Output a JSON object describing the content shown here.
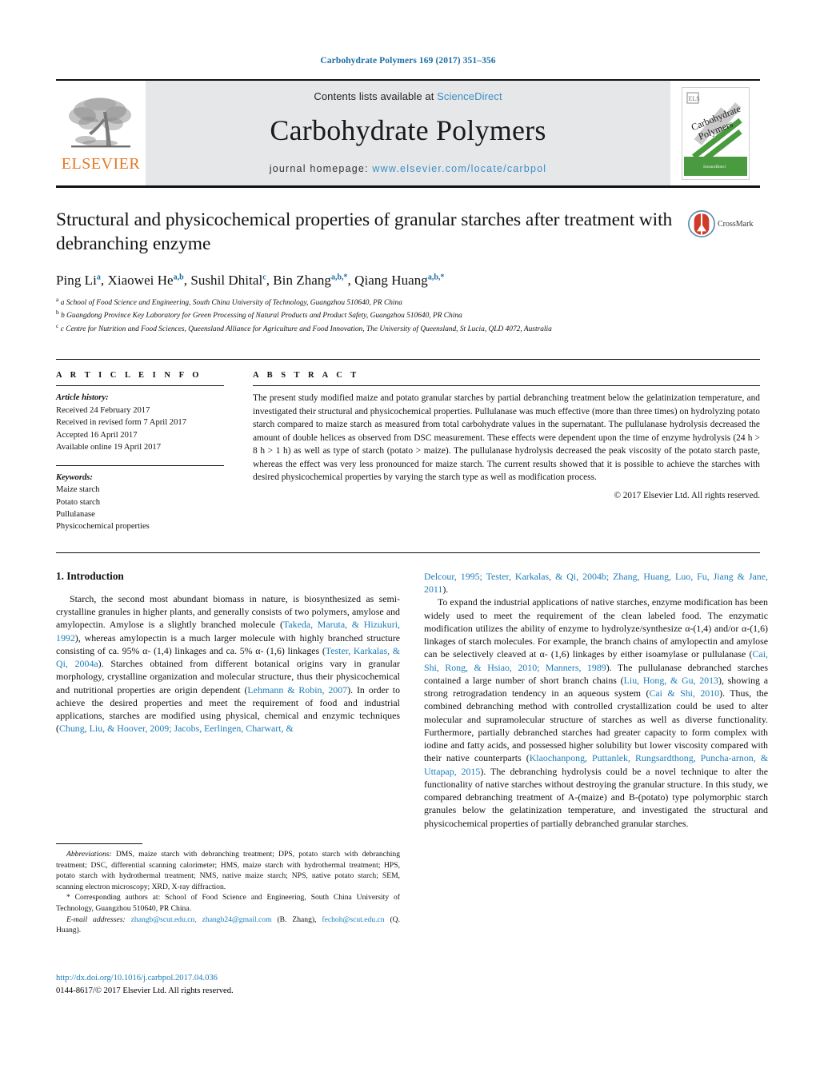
{
  "running_head": "Carbohydrate Polymers 169 (2017) 351–356",
  "masthead": {
    "contents_prefix": "Contents lists available at ",
    "sciencedirect": "ScienceDirect",
    "journal_name": "Carbohydrate Polymers",
    "homepage_prefix": "journal homepage: ",
    "homepage_url": "www.elsevier.com/locate/carbpol",
    "publisher_logo_text": "ELSEVIER",
    "cover_title_line1": "Carbohydrate",
    "cover_title_line2": "Polymers",
    "accent_blue": "#3b8ec4",
    "elsevier_orange": "#E87722",
    "masthead_grey": "#e6e7e8"
  },
  "article": {
    "title": "Structural and physicochemical properties of granular starches after treatment with debranching enzyme",
    "crossmark_label": "CrossMark",
    "authors_html": "Ping Li<sup>a</sup>, Xiaowei He<sup>a,b</sup>, Sushil Dhital<sup>c</sup>, Bin Zhang<sup>a,b,*</sup>, Qiang Huang<sup>a,b,*</sup>",
    "affiliations": [
      "a School of Food Science and Engineering, South China University of Technology, Guangzhou 510640, PR China",
      "b Guangdong Province Key Laboratory for Green Processing of Natural Products and Product Safety, Guangzhou 510640, PR China",
      "c Centre for Nutrition and Food Sciences, Queensland Alliance for Agriculture and Food Innovation, The University of Queensland, St Lucia, QLD 4072, Australia"
    ]
  },
  "article_info": {
    "heading": "A R T I C L E   I N F O",
    "history_label": "Article history:",
    "history": [
      "Received 24 February 2017",
      "Received in revised form 7 April 2017",
      "Accepted 16 April 2017",
      "Available online 19 April 2017"
    ],
    "keywords_label": "Keywords:",
    "keywords": [
      "Maize starch",
      "Potato starch",
      "Pullulanase",
      "Physicochemical properties"
    ]
  },
  "abstract": {
    "heading": "A B S T R A C T",
    "text": "The present study modified maize and potato granular starches by partial debranching treatment below the gelatinization temperature, and investigated their structural and physicochemical properties. Pullulanase was much effective (more than three times) on hydrolyzing potato starch compared to maize starch as measured from total carbohydrate values in the supernatant. The pullulanase hydrolysis decreased the amount of double helices as observed from DSC measurement. These effects were dependent upon the time of enzyme hydrolysis (24 h > 8 h > 1 h) as well as type of starch (potato > maize). The pullulanase hydrolysis decreased the peak viscosity of the potato starch paste, whereas the effect was very less pronounced for maize starch. The current results showed that it is possible to achieve the starches with desired physicochemical properties by varying the starch type as well as modification process.",
    "copyright": "© 2017 Elsevier Ltd. All rights reserved."
  },
  "body": {
    "section_heading": "1.  Introduction",
    "left_paragraph_html": "Starch, the second most abundant biomass in nature, is biosynthesized as semi-crystalline granules in higher plants, and generally consists of two polymers, amylose and amylopectin. Amylose is a slightly branched molecule (<span class=\"ref\">Takeda, Maruta, &amp; Hizukuri, 1992</span>), whereas amylopectin is a much larger molecule with highly branched structure consisting of ca. 95% &#945;- (1,4) linkages and ca. 5% &#945;- (1,6) linkages (<span class=\"ref\">Tester, Karkalas, &amp; Qi, 2004a</span>). Starches obtained from different botanical origins vary in granular morphology, crystalline organization and molecular structure, thus their physicochemical and nutritional properties are origin dependent (<span class=\"ref\">Lehmann &amp; Robin, 2007</span>). In order to achieve the desired properties and meet the requirement of food and industrial applications, starches are modified using physical, chemical and enzymic techniques (<span class=\"ref\">Chung, Liu, &amp; Hoover, 2009; Jacobs, Eerlingen, Charwart, &amp;</span>",
    "right_paragraph1_html": "<span class=\"ref\">Delcour, 1995; Tester, Karkalas, &amp; Qi, 2004b; Zhang, Huang, Luo, Fu, Jiang &amp; Jane, 2011</span>).",
    "right_paragraph2_html": "To expand the industrial applications of native starches, enzyme modification has been widely used to meet the requirement of the clean labeled food. The enzymatic modification utilizes the ability of enzyme to hydrolyze/synthesize &#945;-(1,4) and/or &#945;-(1,6) linkages of starch molecules. For example, the branch chains of amylopectin and amylose can be selectively cleaved at &#945;- (1,6) linkages by either isoamylase or pullulanase (<span class=\"ref\">Cai, Shi, Rong, &amp; Hsiao, 2010; Manners, 1989</span>). The pullulanase debranched starches contained a large number of short branch chains (<span class=\"ref\">Liu, Hong, &amp; Gu, 2013</span>), showing a strong retrogradation tendency in an aqueous system (<span class=\"ref\">Cai &amp; Shi, 2010</span>). Thus, the combined debranching method with controlled crystallization could be used to alter molecular and supramolecular structure of starches as well as diverse functionality. Furthermore, partially debranched starches had greater capacity to form complex with iodine and fatty acids, and possessed higher solubility but lower viscosity compared with their native counterparts (<span class=\"ref\">Klaochanpong, Puttanlek, Rungsardthong, Puncha-arnon, &amp; Uttapap, 2015</span>). The debranching hydrolysis could be a novel technique to alter the functionality of native starches without destroying the granular structure. In this study, we compared debranching treatment of A-(maize) and B-(potato) type polymorphic starch granules below the gelatinization temperature, and investigated the structural and physicochemical properties of partially debranched granular starches."
  },
  "footnote": {
    "abbreviations_label": "Abbreviations:",
    "abbreviations_text": "  DMS, maize starch with debranching treatment; DPS, potato starch with debranching treatment; DSC, differential scanning calorimeter; HMS, maize starch with hydrothermal treatment; HPS, potato starch with hydrothermal treatment; NMS, native maize starch; NPS, native potato starch; SEM, scanning electron microscopy; XRD, X-ray diffraction.",
    "corresponding_text": "* Corresponding authors at: School of Food Science and Engineering, South China University of Technology, Guangzhou 510640, PR China.",
    "email_label": "E-mail addresses:",
    "email_1": "zhangb@scut.edu.cn, zhangb24@gmail.com",
    "email_1_owner": " (B. Zhang),",
    "email_2": "fechoh@scut.edu.cn",
    "email_2_owner": " (Q. Huang)."
  },
  "doi": {
    "url": "http://dx.doi.org/10.1016/j.carbpol.2017.04.036",
    "issn_line": "0144-8617/© 2017 Elsevier Ltd. All rights reserved."
  }
}
